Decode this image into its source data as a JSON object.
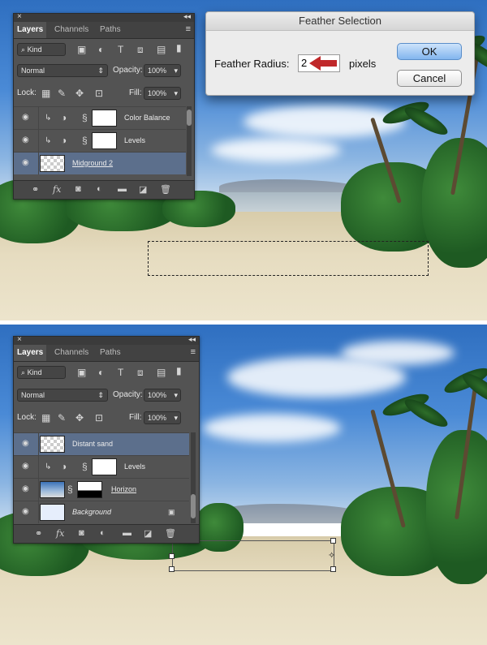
{
  "top_panel": {
    "tabs": [
      "Layers",
      "Channels",
      "Paths"
    ],
    "filter_value": "Kind",
    "blend_mode": "Normal",
    "opacity_label": "Opacity:",
    "opacity_value": "100%",
    "lock_label": "Lock:",
    "fill_label": "Fill:",
    "fill_value": "100%",
    "layers": [
      {
        "name": "Color Balance"
      },
      {
        "name": "Levels"
      },
      {
        "name": "Midground 2"
      }
    ],
    "bottom_icons": [
      "link-icon",
      "fx-icon",
      "mask-icon",
      "adjustment-icon",
      "folder-icon",
      "new-layer-icon",
      "trash-icon"
    ],
    "bottom_fx": "fx"
  },
  "dialog": {
    "title": "Feather Selection",
    "label": "Feather Radius:",
    "value": "2",
    "unit": "pixels",
    "ok": "OK",
    "cancel": "Cancel"
  },
  "bottom_panel": {
    "tabs": [
      "Layers",
      "Channels",
      "Paths"
    ],
    "filter_value": "Kind",
    "blend_mode": "Normal",
    "opacity_label": "Opacity:",
    "opacity_value": "100%",
    "lock_label": "Lock:",
    "fill_label": "Fill:",
    "fill_value": "100%",
    "layers": [
      {
        "name": "Distant sand"
      },
      {
        "name": "Levels"
      },
      {
        "name": "Horizon"
      },
      {
        "name": "Background"
      }
    ],
    "bottom_fx": "fx"
  },
  "icons": {
    "close": "×",
    "collapse": "◂◂",
    "menu": "≡",
    "eye": "◉",
    "lock": "🔒",
    "chain": "⛓",
    "search": "⌕"
  },
  "colors": {
    "panel_bg": "#535353",
    "selected_layer": "#5c6f8c",
    "arrow_red": "#c0282a"
  }
}
